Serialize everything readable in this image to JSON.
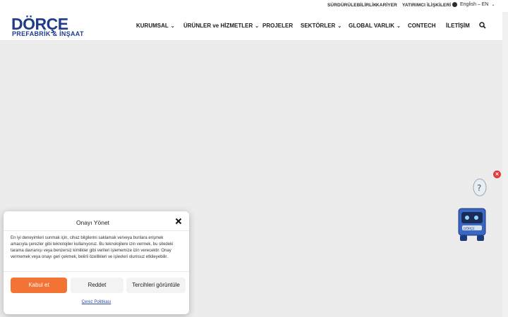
{
  "topbar": {
    "links": [
      "SÜRDÜRÜLEBİLİRLİK",
      "KARİYER",
      "YATIRIMCI İLİŞKİLERİ"
    ],
    "language": "English – EN"
  },
  "logo": {
    "brand": "DÖRÇE",
    "sub": "PREFABRİK & İNŞAAT"
  },
  "nav": {
    "items": [
      "KURUMSAL",
      "ÜRÜNLER ve HİZMETLER",
      "PROJELER",
      "SEKTÖRLER",
      "GLOBAL VARLIK",
      "CONTECH",
      "İLETİŞİM"
    ],
    "chevron": "⌄"
  },
  "mascot": {
    "label": "DÖRÇE"
  },
  "consent": {
    "title": "Onayı Yönet",
    "body": "En iyi deneyimleri sunmak için, cihaz bilgilerini saklamak ve/veya bunlara erişmek amacıyla çerezler gibi teknolojiler kullanıyoruz. Bu teknolojilere izin vermek, bu sitedeki tarama davranışı veya benzersiz kimlikler gibi verileri işlememize izin verecektir. Onay vermemek veya onayı geri çekmek, belirli özellikleri ve işlevleri olumsuz etkileyebilir.",
    "accept": "Kabul et",
    "deny": "Reddet",
    "preferences": "Tercihleri görüntüle",
    "policy": "Çerez Politikası"
  },
  "colors": {
    "brand_blue": "#1f3c8c",
    "accent_orange": "#f27333",
    "close_red": "#e33a3a"
  }
}
